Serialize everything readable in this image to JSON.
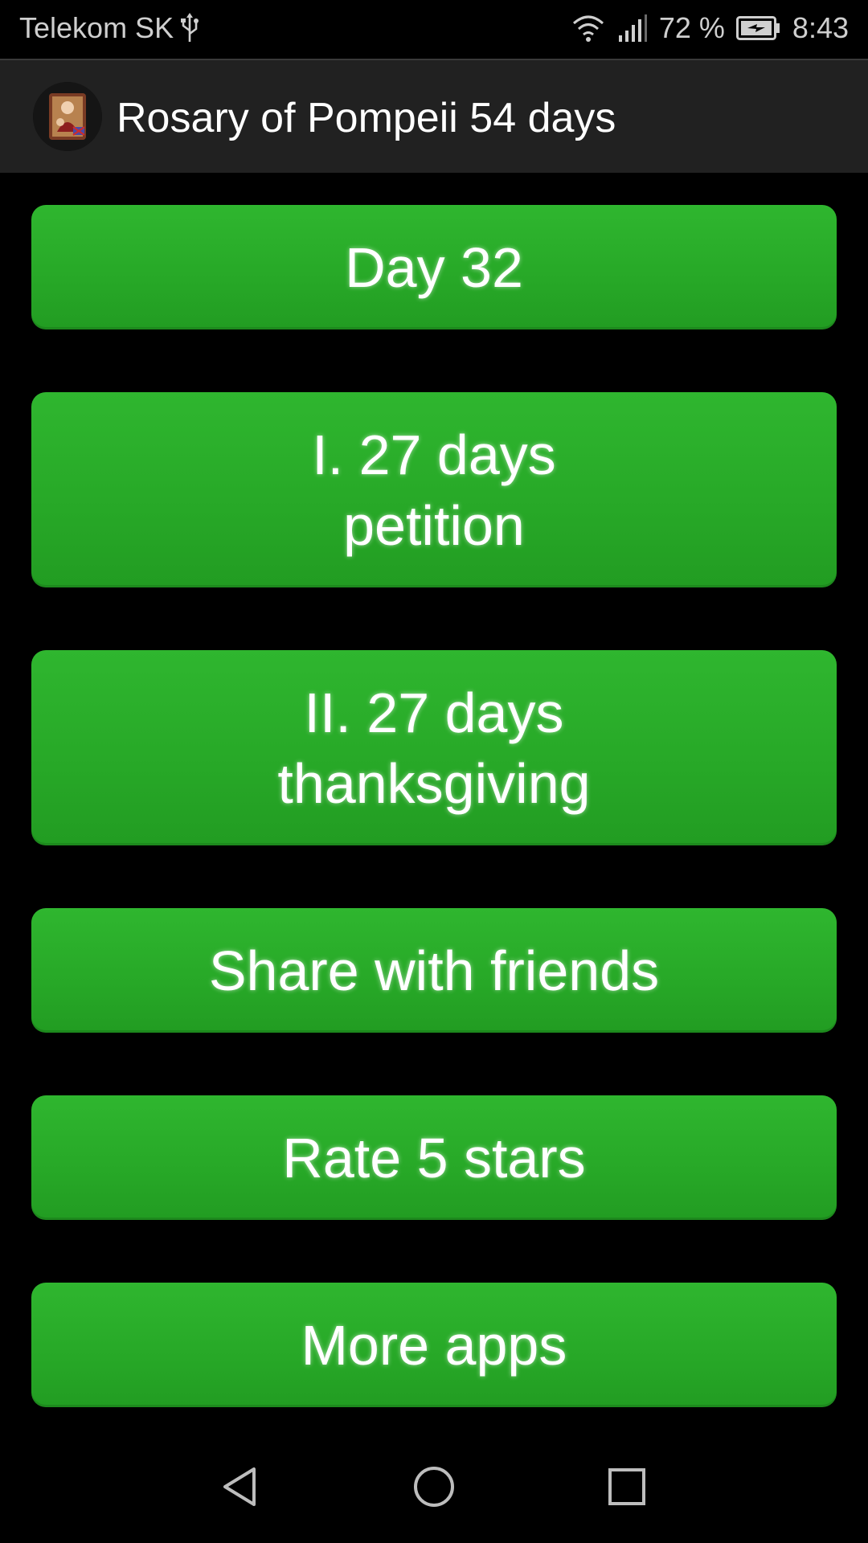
{
  "status_bar": {
    "carrier": "Telekom SK",
    "battery_percent": "72 %",
    "time": "8:43",
    "icons": [
      "usb-icon",
      "wifi-icon",
      "signal-icon",
      "battery-charging-icon"
    ]
  },
  "app_bar": {
    "title": "Rosary of Pompeii 54 days",
    "icon": "app-icon"
  },
  "buttons": [
    {
      "id": "day",
      "label": "Day 32"
    },
    {
      "id": "petition",
      "label": "I. 27 days\npetition"
    },
    {
      "id": "thanksgiving",
      "label": "II. 27 days\nthanksgiving"
    },
    {
      "id": "share",
      "label": "Share with friends"
    },
    {
      "id": "rate",
      "label": "Rate 5 stars"
    },
    {
      "id": "more",
      "label": "More apps"
    }
  ],
  "nav_bar": {
    "icons": [
      "back-icon",
      "home-icon",
      "recents-icon"
    ]
  },
  "colors": {
    "button_green": "#27a827",
    "app_bar": "#212121",
    "background": "#000000"
  }
}
